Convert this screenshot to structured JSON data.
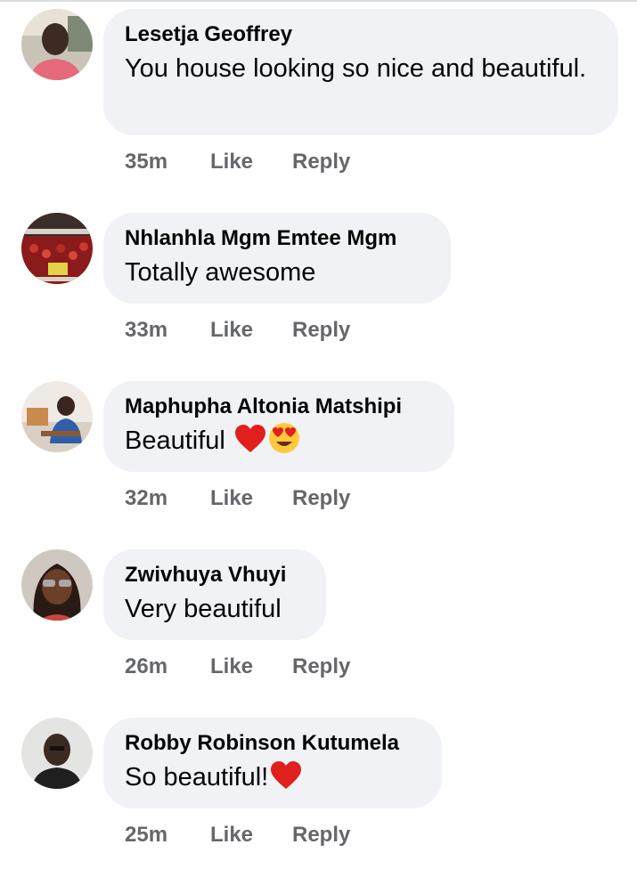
{
  "comments": [
    {
      "author": "Lesetja Geoffrey",
      "text": "You house looking so nice  and beautiful.",
      "emoji": [],
      "time": "35m",
      "like_label": "Like",
      "reply_label": "Reply",
      "avatar_icon": "profile-photo-man-pink-shirt"
    },
    {
      "author": "Nhlanhla Mgm Emtee Mgm",
      "text": "Totally awesome",
      "emoji": [],
      "time": "33m",
      "like_label": "Like",
      "reply_label": "Reply",
      "avatar_icon": "profile-photo-crowd-red"
    },
    {
      "author": "Maphupha Altonia Matshipi",
      "text": "Beautiful",
      "emoji": [
        "red-heart",
        "heart-eyes-face"
      ],
      "time": "32m",
      "like_label": "Like",
      "reply_label": "Reply",
      "avatar_icon": "profile-photo-woman-desk"
    },
    {
      "author": "Zwivhuya Vhuyi",
      "text": "Very beautiful",
      "emoji": [],
      "time": "26m",
      "like_label": "Like",
      "reply_label": "Reply",
      "avatar_icon": "profile-photo-woman-sunglasses"
    },
    {
      "author": "Robby Robinson Kutumela",
      "text": "So beautiful!",
      "emoji": [
        "red-heart"
      ],
      "time": "25m",
      "like_label": "Like",
      "reply_label": "Reply",
      "avatar_icon": "profile-photo-bald-man"
    }
  ],
  "colors": {
    "bubble_bg": "#f0f2f5",
    "name_text": "#050505",
    "meta_text": "#65676b",
    "heart_red": "#e0201c",
    "emoji_yellow": "#ffc83d"
  }
}
